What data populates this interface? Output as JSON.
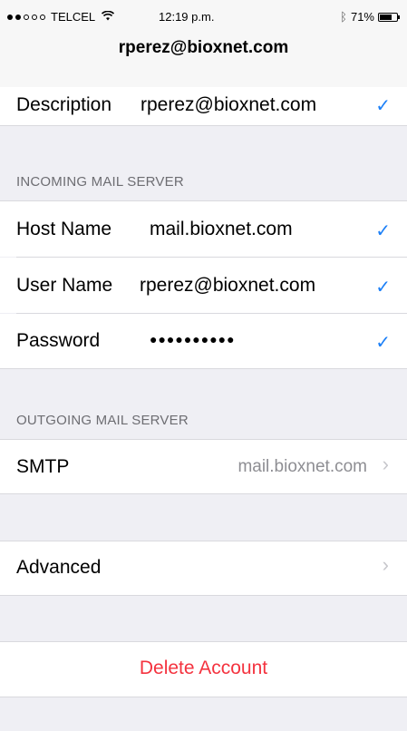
{
  "status_bar": {
    "signal_full": 2,
    "signal_empty": 3,
    "carrier": "TELCEL",
    "wifi_icon": "wifi-icon",
    "time": "12:19 p.m.",
    "bluetooth_icon": "bluetooth-icon",
    "battery_text": "71%",
    "battery_level": 0.71
  },
  "nav": {
    "title": "rperez@bioxnet.com"
  },
  "account": {
    "description_label": "Description",
    "description_value": "rperez@bioxnet.com"
  },
  "incoming": {
    "header": "INCOMING MAIL SERVER",
    "host_label": "Host Name",
    "host_value": "mail.bioxnet.com",
    "user_label": "User Name",
    "user_value": "rperez@bioxnet.com",
    "password_label": "Password",
    "password_value": "●●●●●●●●●●"
  },
  "outgoing": {
    "header": "OUTGOING MAIL SERVER",
    "smtp_label": "SMTP",
    "smtp_value": "mail.bioxnet.com"
  },
  "advanced_label": "Advanced",
  "delete_label": "Delete Account",
  "colors": {
    "accent": "#1b7ff7",
    "destructive": "#f4333f",
    "background": "#efeff4"
  },
  "icons": {
    "check": "✓",
    "chevron": "›"
  }
}
